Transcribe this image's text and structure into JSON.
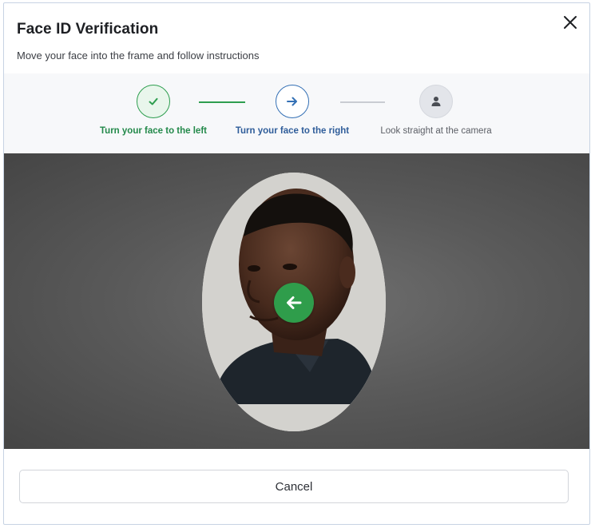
{
  "dialog": {
    "title": "Face ID Verification",
    "subtitle": "Move your face into the frame and follow instructions"
  },
  "steps": [
    {
      "label": "Turn your face to the left",
      "status": "completed",
      "icon": "check-icon"
    },
    {
      "label": "Turn your face to the right",
      "status": "active",
      "icon": "arrow-right-icon"
    },
    {
      "label": "Look straight at the camera",
      "status": "pending",
      "icon": "person-icon"
    }
  ],
  "camera": {
    "direction_indicator": "arrow-left-icon"
  },
  "footer": {
    "cancel_label": "Cancel"
  },
  "colors": {
    "success": "#2e9e4f",
    "active": "#3470b5",
    "pending": "#e3e5ea",
    "camera_bg": "#5a5a5a"
  }
}
